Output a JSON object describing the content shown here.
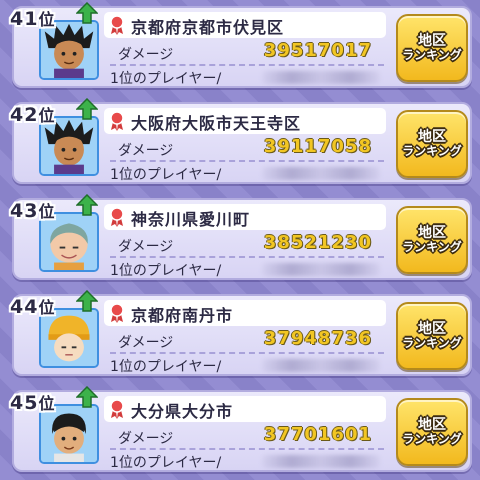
{
  "labels": {
    "rank_suffix": "位",
    "damage_label": "ダメージ",
    "top_player_label": "1位のプレイヤー/",
    "ranking_button_line1": "地区",
    "ranking_button_line2": "ランキング"
  },
  "colors": {
    "card_bg": "#e4e1f8",
    "damage_value": "#f2c623",
    "button_bg": "#f5c52c",
    "up_arrow": "#3cb24a",
    "avatar_frame": "#3f8fe0"
  },
  "icons": {
    "rank_change": "up-arrow-icon",
    "region_marker": "medal-ribbon-icon"
  },
  "entries": [
    {
      "rank": "41",
      "region": "京都府京都市伏見区",
      "damage": "39517017",
      "avatar": "spiky-hair-boy",
      "player_name_blurred": true
    },
    {
      "rank": "42",
      "region": "大阪府大阪市天王寺区",
      "damage": "39117058",
      "avatar": "spiky-hair-boy",
      "player_name_blurred": true
    },
    {
      "rank": "43",
      "region": "神奈川県愛川町",
      "damage": "38521230",
      "avatar": "old-man",
      "player_name_blurred": true
    },
    {
      "rank": "44",
      "region": "京都府南丹市",
      "damage": "37948736",
      "avatar": "beanie-kid",
      "player_name_blurred": true
    },
    {
      "rank": "45",
      "region": "大分県大分市",
      "damage": "37701601",
      "avatar": "short-hair-boy",
      "player_name_blurred": true
    }
  ]
}
